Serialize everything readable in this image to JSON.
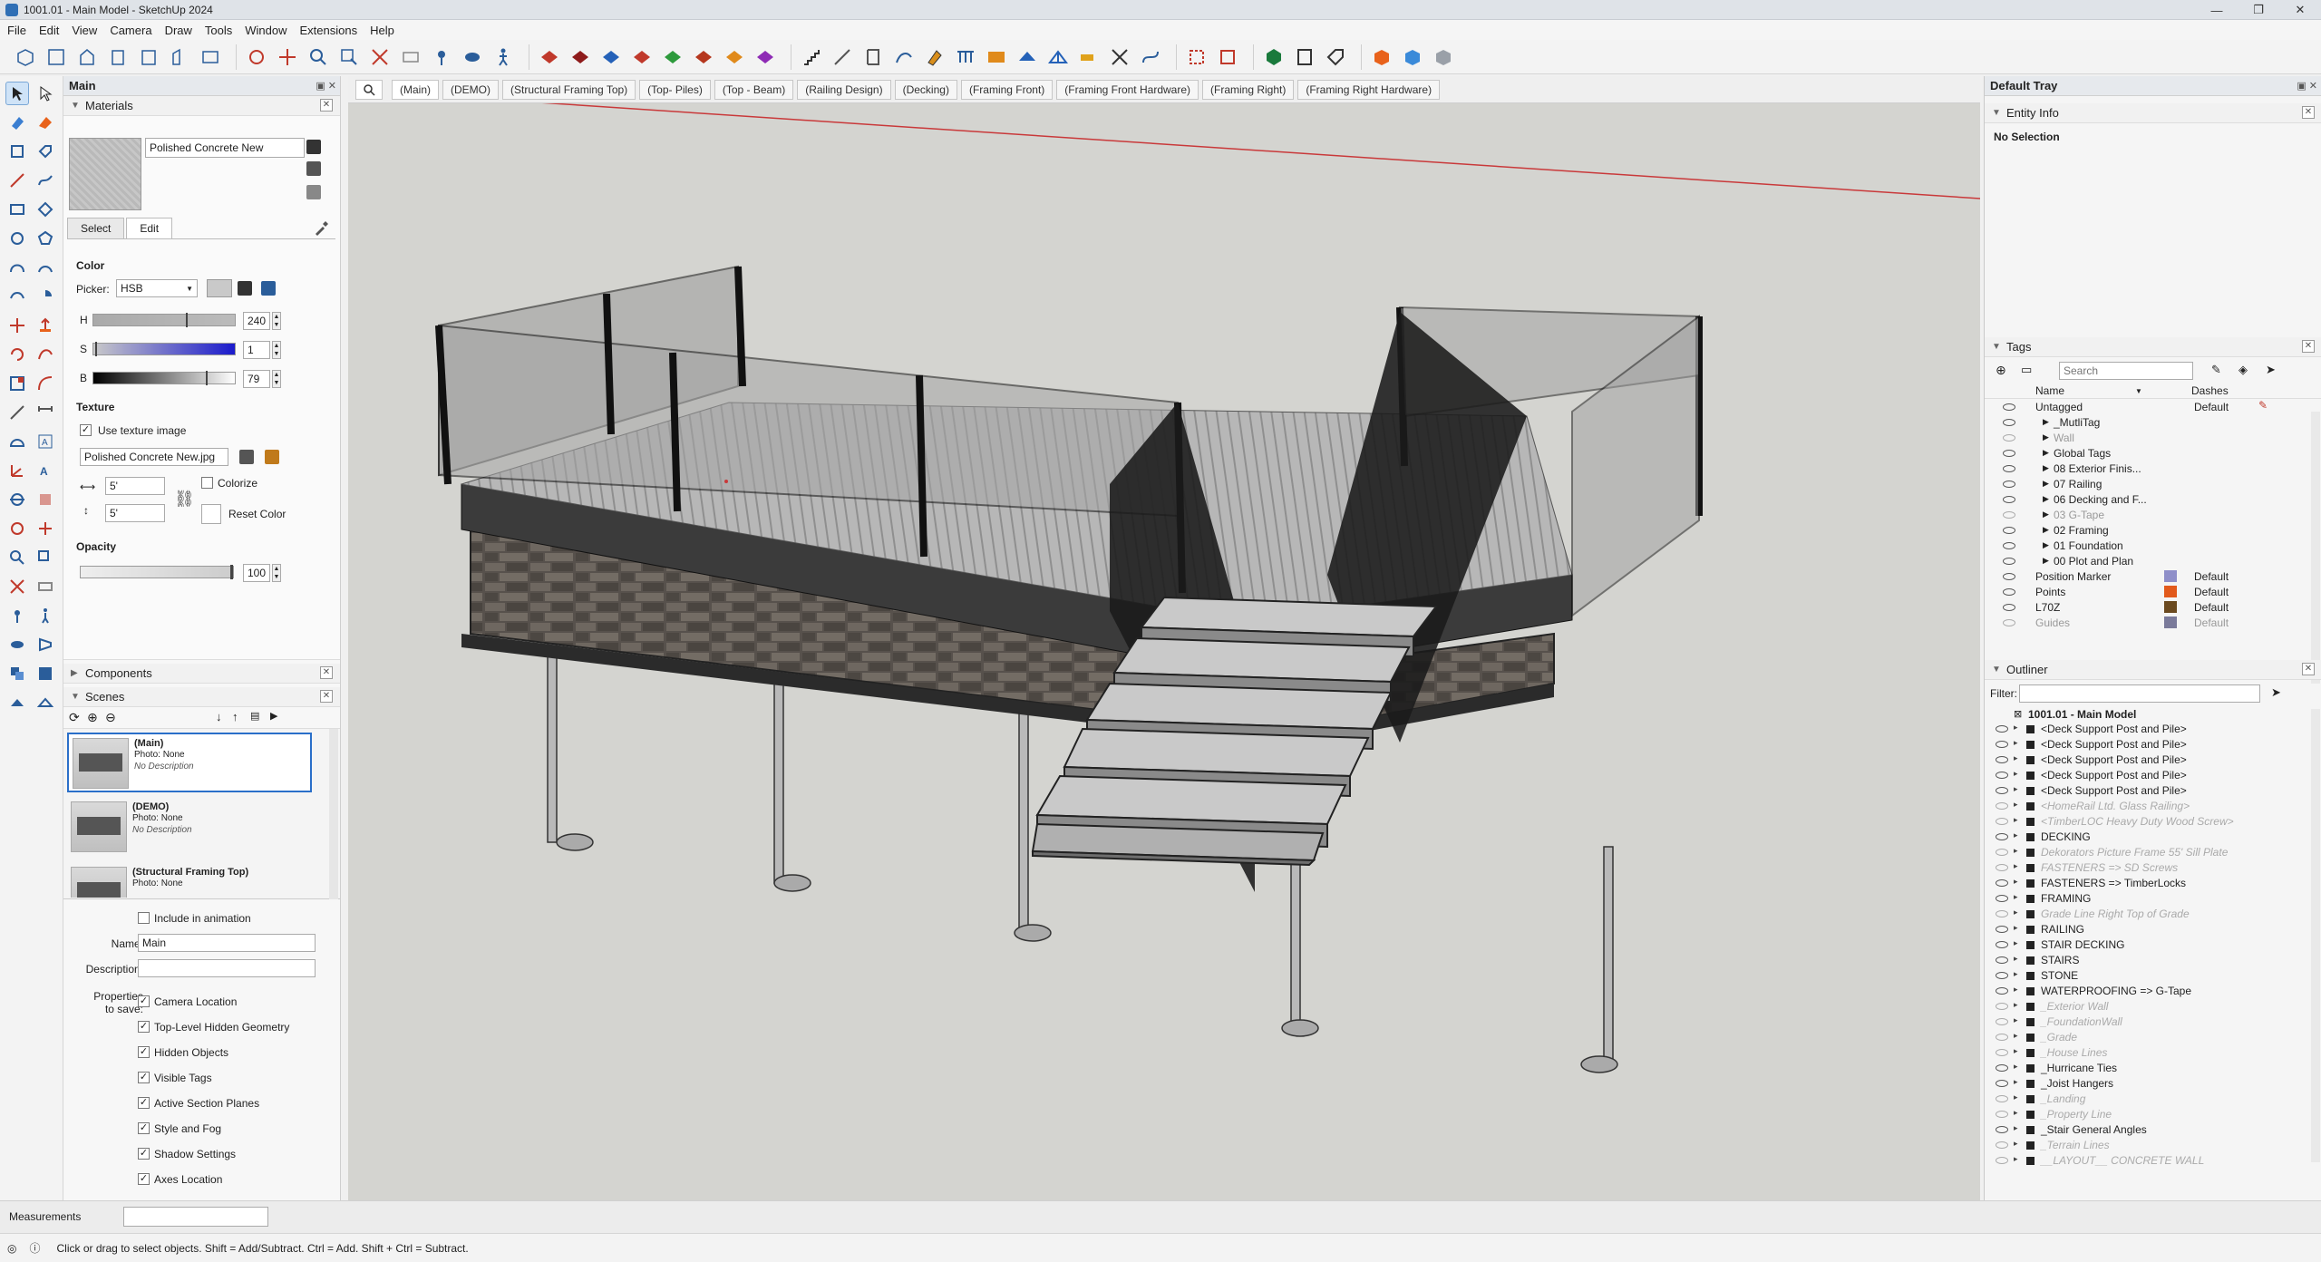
{
  "window": {
    "title": "1001.01 - Main Model - SketchUp 2024",
    "controls": [
      "—",
      "❐",
      "✕"
    ]
  },
  "menu": [
    "File",
    "Edit",
    "View",
    "Camera",
    "Draw",
    "Tools",
    "Window",
    "Extensions",
    "Help"
  ],
  "left_tray": {
    "title": "Main",
    "materials": {
      "header": "Materials",
      "name": "Polished Concrete New",
      "tabs": [
        "Select",
        "Edit"
      ],
      "color_label": "Color",
      "picker_label": "Picker:",
      "picker_value": "HSB",
      "h_label": "H",
      "h_value": "240",
      "s_label": "S",
      "s_value": "1",
      "b_label": "B",
      "b_value": "79",
      "texture_label": "Texture",
      "use_texture_label": "Use texture image",
      "texture_file": "Polished Concrete New.jpg",
      "width_value": "5'",
      "height_value": "5'",
      "colorize_label": "Colorize",
      "reset_color_label": "Reset Color",
      "opacity_label": "Opacity",
      "opacity_value": "100"
    },
    "components": {
      "header": "Components"
    },
    "scenes": {
      "header": "Scenes",
      "items": [
        {
          "title": "(Main)",
          "photo": "Photo: None",
          "desc": "No Description"
        },
        {
          "title": "(DEMO)",
          "photo": "Photo: None",
          "desc": "No Description"
        },
        {
          "title": "(Structural Framing Top)",
          "photo": "Photo: None",
          "desc": ""
        }
      ],
      "include_animation": "Include in animation",
      "name_label": "Name:",
      "name_value": "Main",
      "description_label": "Description:",
      "properties_label": "Properties",
      "to_save_label": "to save:",
      "props": [
        "Camera Location",
        "Top-Level Hidden Geometry",
        "Hidden Objects",
        "Visible Tags",
        "Active Section Planes",
        "Style and Fog",
        "Shadow Settings",
        "Axes Location"
      ]
    }
  },
  "scene_tabs": [
    "(Main)",
    "(DEMO)",
    "(Structural Framing Top)",
    "(Top- Piles)",
    "(Top - Beam)",
    "(Railing Design)",
    "(Decking)",
    "(Framing Front)",
    "(Framing Front Hardware)",
    "(Framing Right)",
    "(Framing Right Hardware)"
  ],
  "right_tray": {
    "title": "Default Tray",
    "entity_info": {
      "header": "Entity Info",
      "text": "No Selection"
    },
    "tags": {
      "header": "Tags",
      "search_placeholder": "Search",
      "col_name": "Name",
      "col_dashes": "Dashes",
      "rows": [
        {
          "name": "Untagged",
          "indent": 0,
          "dim": false,
          "visible": true,
          "dashes": "Default",
          "color": ""
        },
        {
          "name": "_MutliTag",
          "indent": 1,
          "dim": false,
          "visible": true,
          "dashes": "",
          "color": ""
        },
        {
          "name": "Wall",
          "indent": 1,
          "dim": true,
          "visible": false,
          "dashes": "",
          "color": ""
        },
        {
          "name": "Global Tags",
          "indent": 1,
          "dim": false,
          "visible": true,
          "dashes": "",
          "color": ""
        },
        {
          "name": "08 Exterior Finis...",
          "indent": 1,
          "dim": false,
          "visible": true,
          "dashes": "",
          "color": ""
        },
        {
          "name": "07 Railing",
          "indent": 1,
          "dim": false,
          "visible": true,
          "dashes": "",
          "color": ""
        },
        {
          "name": "06 Decking and F...",
          "indent": 1,
          "dim": false,
          "visible": true,
          "dashes": "",
          "color": ""
        },
        {
          "name": "03 G-Tape",
          "indent": 1,
          "dim": true,
          "visible": false,
          "dashes": "",
          "color": ""
        },
        {
          "name": "02 Framing",
          "indent": 1,
          "dim": false,
          "visible": true,
          "dashes": "",
          "color": ""
        },
        {
          "name": "01 Foundation",
          "indent": 1,
          "dim": false,
          "visible": true,
          "dashes": "",
          "color": ""
        },
        {
          "name": "00 Plot and Plan",
          "indent": 1,
          "dim": false,
          "visible": true,
          "dashes": "",
          "color": ""
        },
        {
          "name": "Position Marker",
          "indent": 0,
          "dim": false,
          "visible": true,
          "dashes": "Default",
          "color": "#8f8fc9"
        },
        {
          "name": "Points",
          "indent": 0,
          "dim": false,
          "visible": true,
          "dashes": "Default",
          "color": "#e25a1c"
        },
        {
          "name": "L70Z",
          "indent": 0,
          "dim": false,
          "visible": true,
          "dashes": "Default",
          "color": "#6b4a1f"
        },
        {
          "name": "Guides",
          "indent": 0,
          "dim": true,
          "visible": false,
          "dashes": "Default",
          "color": "#7a7a9a"
        }
      ]
    },
    "outliner": {
      "header": "Outliner",
      "filter_label": "Filter:",
      "root": "1001.01 - Main Model",
      "rows": [
        {
          "name": "<Deck Support Post and Pile>",
          "dim": false,
          "visible": true
        },
        {
          "name": "<Deck Support Post and Pile>",
          "dim": false,
          "visible": true
        },
        {
          "name": "<Deck Support Post and Pile>",
          "dim": false,
          "visible": true
        },
        {
          "name": "<Deck Support Post and Pile>",
          "dim": false,
          "visible": true
        },
        {
          "name": "<Deck Support Post and Pile>",
          "dim": false,
          "visible": true
        },
        {
          "name": "<HomeRail Ltd. Glass Railing>",
          "dim": true,
          "visible": false
        },
        {
          "name": "<TimberLOC Heavy Duty Wood Screw>",
          "dim": true,
          "visible": false
        },
        {
          "name": "DECKING",
          "dim": false,
          "visible": true
        },
        {
          "name": "Dekorators Picture Frame 55' Sill Plate",
          "dim": true,
          "visible": false
        },
        {
          "name": "FASTENERS => SD Screws",
          "dim": true,
          "visible": false
        },
        {
          "name": "FASTENERS => TimberLocks",
          "dim": false,
          "visible": true
        },
        {
          "name": "FRAMING",
          "dim": false,
          "visible": true
        },
        {
          "name": "Grade Line Right Top of Grade",
          "dim": true,
          "visible": false
        },
        {
          "name": "RAILING",
          "dim": false,
          "visible": true
        },
        {
          "name": "STAIR DECKING",
          "dim": false,
          "visible": true
        },
        {
          "name": "STAIRS",
          "dim": false,
          "visible": true
        },
        {
          "name": "STONE",
          "dim": false,
          "visible": true
        },
        {
          "name": "WATERPROOFING => G-Tape",
          "dim": false,
          "visible": true
        },
        {
          "name": "_Exterior Wall",
          "dim": true,
          "visible": false
        },
        {
          "name": "_FoundationWall",
          "dim": true,
          "visible": false
        },
        {
          "name": "_Grade",
          "dim": true,
          "visible": false
        },
        {
          "name": "_House Lines",
          "dim": true,
          "visible": false
        },
        {
          "name": "_Hurricane Ties",
          "dim": false,
          "visible": true
        },
        {
          "name": "_Joist Hangers",
          "dim": false,
          "visible": true
        },
        {
          "name": "_Landing",
          "dim": true,
          "visible": false
        },
        {
          "name": "_Property Line",
          "dim": true,
          "visible": false
        },
        {
          "name": "_Stair General Angles",
          "dim": false,
          "visible": true
        },
        {
          "name": "_Terrain Lines",
          "dim": true,
          "visible": false
        },
        {
          "name": "__LAYOUT__ CONCRETE WALL",
          "dim": true,
          "visible": false
        }
      ]
    }
  },
  "measurements_label": "Measurements",
  "status_text": "Click or drag to select objects. Shift = Add/Subtract. Ctrl = Add. Shift + Ctrl = Subtract."
}
